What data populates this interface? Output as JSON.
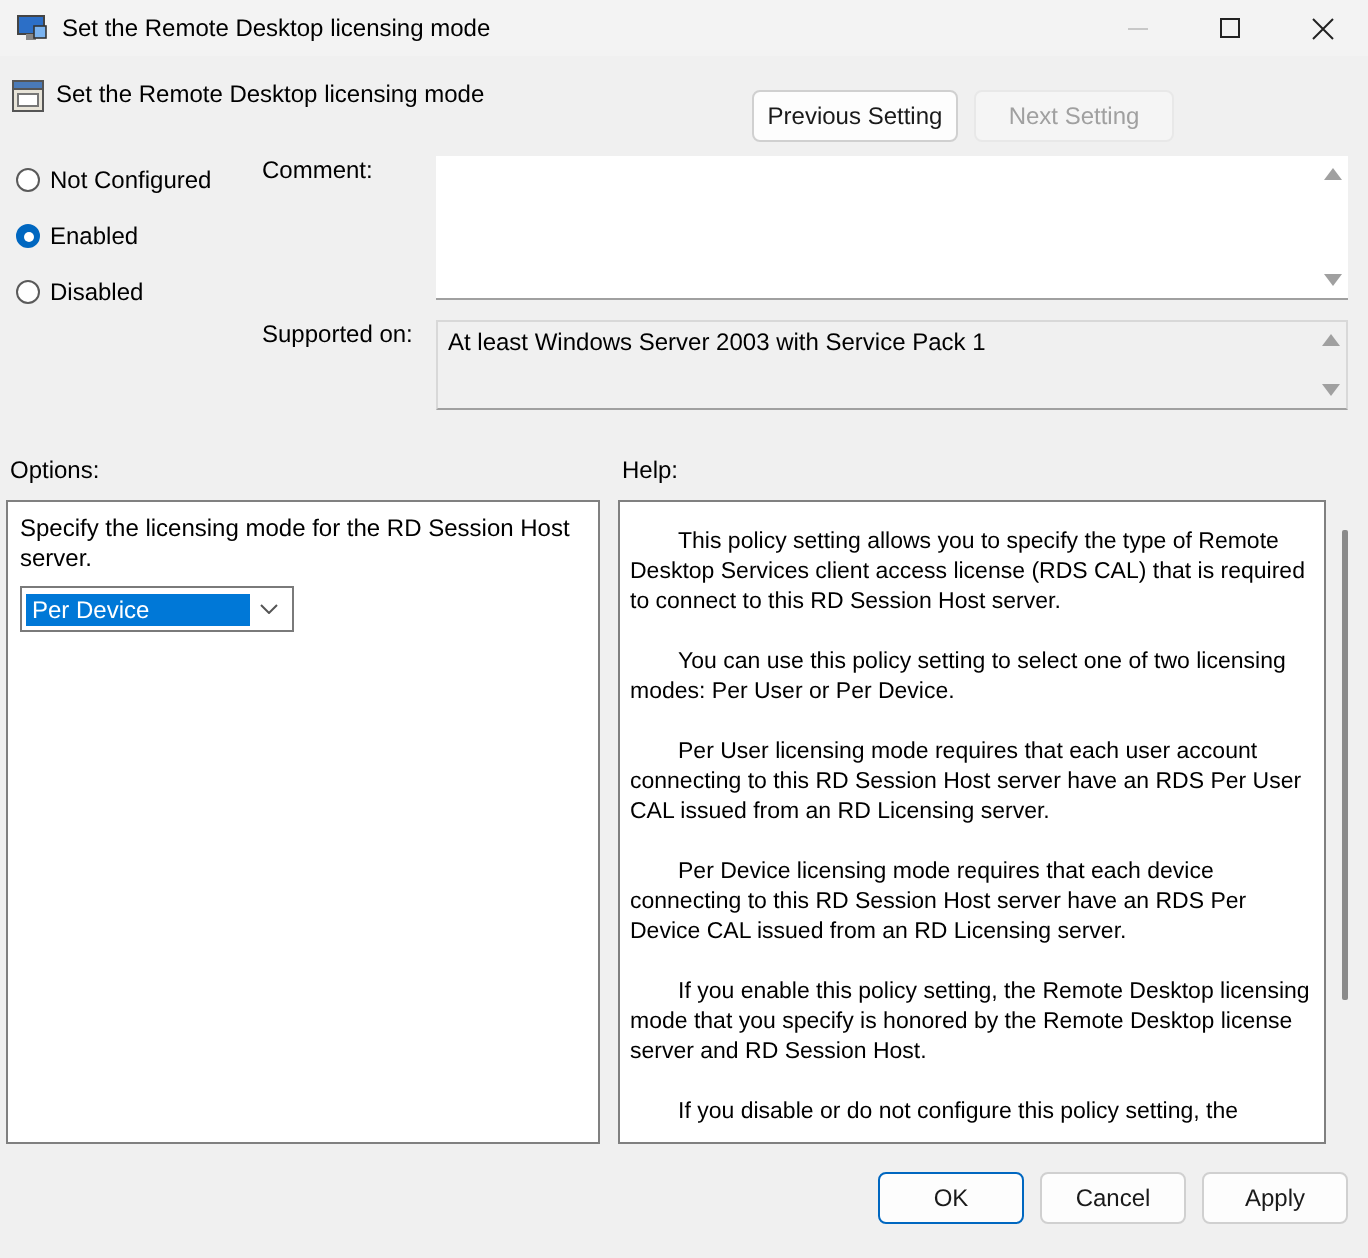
{
  "window": {
    "title": "Set the Remote Desktop licensing mode"
  },
  "header": {
    "title": "Set the Remote Desktop licensing mode",
    "buttons": [
      {
        "label": "Previous Setting",
        "disabled": false
      },
      {
        "label": "Next Setting",
        "disabled": true
      }
    ]
  },
  "state_options": [
    {
      "label": "Not Configured",
      "selected": false
    },
    {
      "label": "Enabled",
      "selected": true
    },
    {
      "label": "Disabled",
      "selected": false
    }
  ],
  "comment": {
    "label": "Comment:"
  },
  "supported_on": {
    "label": "Supported on:",
    "value": "At least Windows Server 2003 with Service Pack 1"
  },
  "options": {
    "label": "Options:",
    "description": "Specify the licensing mode for the RD Session Host server.",
    "dropdown": {
      "value": "Per Device"
    }
  },
  "help": {
    "label": "Help:",
    "paragraphs": [
      "This policy setting allows you to specify the type of Remote Desktop Services client access license (RDS CAL) that is required to connect to this RD Session Host server.",
      "You can use this policy setting to select one of two licensing modes: Per User or Per Device.",
      "Per User licensing mode requires that each user account connecting to this RD Session Host server have an RDS Per User CAL issued from an RD Licensing server.",
      "Per Device licensing mode requires that each device connecting to this RD Session Host server have an RDS Per Device CAL issued from an RD Licensing server.",
      "If you enable this policy setting, the Remote Desktop licensing mode that you specify is honored by the Remote Desktop license server and RD Session Host.",
      "If you disable or do not configure this policy setting, the"
    ]
  },
  "footer_buttons": [
    {
      "label": "OK",
      "default": true
    },
    {
      "label": "Cancel",
      "default": false
    },
    {
      "label": "Apply",
      "default": false
    }
  ]
}
